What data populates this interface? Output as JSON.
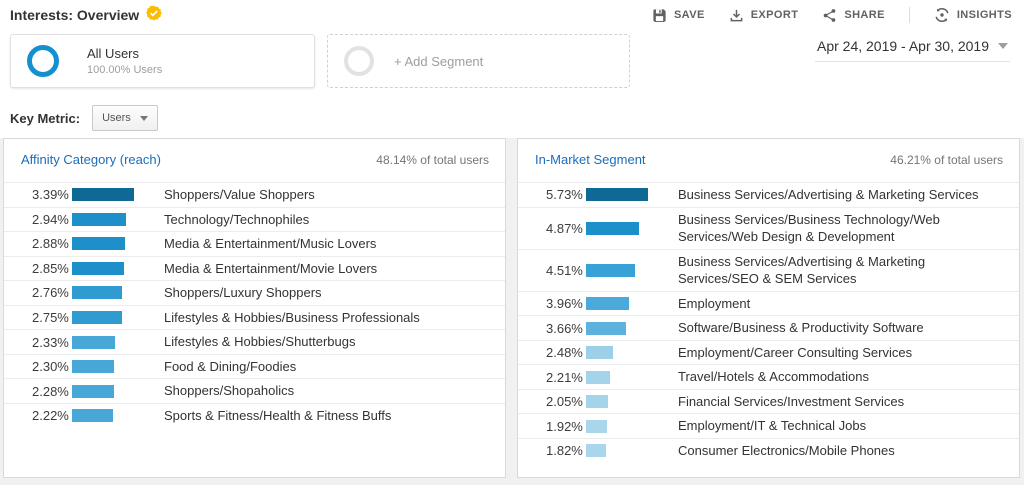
{
  "header": {
    "title": "Interests: Overview",
    "badge": "verified-shield-check",
    "actions": [
      {
        "label": "SAVE",
        "icon": "save-icon"
      },
      {
        "label": "EXPORT",
        "icon": "export-icon"
      },
      {
        "label": "SHARE",
        "icon": "share-icon"
      },
      {
        "label": "INSIGHTS",
        "icon": "insights-icon"
      }
    ]
  },
  "segments": {
    "all_users": {
      "title": "All Users",
      "subtitle": "100.00% Users"
    },
    "add_segment": {
      "label": "+ Add Segment"
    },
    "date_range": "Apr 24, 2019 - Apr 30, 2019"
  },
  "key_metric": {
    "label": "Key Metric:",
    "selected": "Users"
  },
  "colors": {
    "segment_ring_blue": "#1290d0",
    "panel_link_blue": "#1a6dbb",
    "badge_yellow": "#fbbc04"
  },
  "chart_data": [
    {
      "type": "bar",
      "orientation": "horizontal",
      "title": "Affinity Category (reach)",
      "subtitle": "48.14% of total users",
      "value_format": "percent",
      "categories": [
        "Shoppers/Value Shoppers",
        "Technology/Technophiles",
        "Media & Entertainment/Music Lovers",
        "Media & Entertainment/Movie Lovers",
        "Shoppers/Luxury Shoppers",
        "Lifestyles & Hobbies/Business Professionals",
        "Lifestyles & Hobbies/Shutterbugs",
        "Food & Dining/Foodies",
        "Shoppers/Shopaholics",
        "Sports & Fitness/Health & Fitness Buffs"
      ],
      "values": [
        3.39,
        2.94,
        2.88,
        2.85,
        2.76,
        2.75,
        2.33,
        2.3,
        2.28,
        2.22
      ],
      "bar_colors": [
        "#0e6a94",
        "#1e90c9",
        "#1e90c9",
        "#1e90c9",
        "#2f9bd1",
        "#2f9bd1",
        "#47a8d8",
        "#47a8d8",
        "#47a8d8",
        "#47a8d8"
      ]
    },
    {
      "type": "bar",
      "orientation": "horizontal",
      "title": "In-Market Segment",
      "subtitle": "46.21% of total users",
      "value_format": "percent",
      "categories": [
        "Business Services/Advertising & Marketing Services",
        "Business Services/Business Technology/Web Services/Web Design & Development",
        "Business Services/Advertising & Marketing Services/SEO & SEM Services",
        "Employment",
        "Software/Business & Productivity Software",
        "Employment/Career Consulting Services",
        "Travel/Hotels & Accommodations",
        "Financial Services/Investment Services",
        "Employment/IT & Technical Jobs",
        "Consumer Electronics/Mobile Phones"
      ],
      "values": [
        5.73,
        4.87,
        4.51,
        3.96,
        3.66,
        2.48,
        2.21,
        2.05,
        1.92,
        1.82
      ],
      "bar_colors": [
        "#0e6a94",
        "#1e90c9",
        "#38a1d5",
        "#4aaad9",
        "#5cb2dd",
        "#9cd0e8",
        "#a4d4ea",
        "#a4d4ea",
        "#a9d6eb",
        "#a9d6eb"
      ]
    }
  ]
}
